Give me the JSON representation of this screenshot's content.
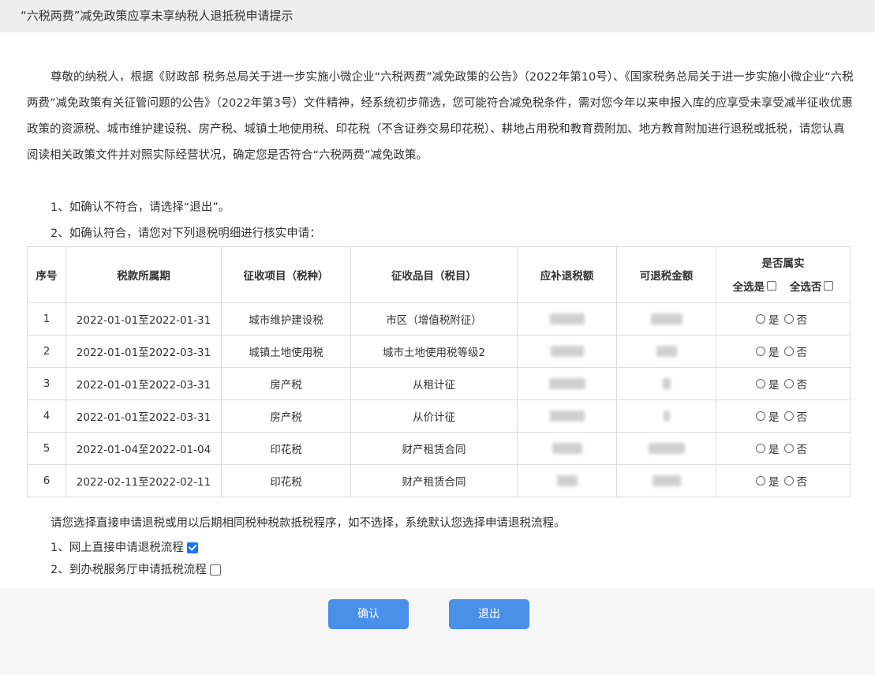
{
  "window": {
    "title": "“六税两费”减免政策应享未享纳税人退抵税申请提示"
  },
  "intro": {
    "paragraph": "尊敬的纳税人，根据《财政部 税务总局关于进一步实施小微企业“六税两费”减免政策的公告》（2022年第10号）、《国家税务总局关于进一步实施小微企业“六税两费”减免政策有关征管问题的公告》（2022年第3号）文件精神，经系统初步筛选，您可能符合减免税条件，需对您今年以来申报入库的应享受未享受减半征收优惠政策的资源税、城市维护建设税、房产税、城镇土地使用税、印花税（不含证券交易印花税）、耕地占用税和教育费附加、地方教育附加进行退税或抵税，请您认真阅读相关政策文件并对照实际经营状况，确定您是否符合“六税两费”减免政策。",
    "line1": "1、如确认不符合，请选择“退出”。",
    "line2": "2、如确认符合，请您对下列退税明细进行核实申请："
  },
  "table": {
    "headers": {
      "seq": "序号",
      "period": "税款所属期",
      "tax_item": "征收项目（税种）",
      "tax_subitem": "征收品目（税目）",
      "refund_due": "应补退税额",
      "refundable": "可退税金额",
      "confirm": "是否属实",
      "select_all_yes": "全选是",
      "select_all_no": "全选否"
    },
    "rows": [
      {
        "seq": "1",
        "period": "2022-01-01至2022-01-31",
        "tax_item": "城市维护建设税",
        "tax_subitem": "市区（增值税附征）",
        "yes": "是",
        "no": "否"
      },
      {
        "seq": "2",
        "period": "2022-01-01至2022-03-31",
        "tax_item": "城镇土地使用税",
        "tax_subitem": "城市土地使用税等级2",
        "yes": "是",
        "no": "否"
      },
      {
        "seq": "3",
        "period": "2022-01-01至2022-03-31",
        "tax_item": "房产税",
        "tax_subitem": "从租计征",
        "yes": "是",
        "no": "否"
      },
      {
        "seq": "4",
        "period": "2022-01-01至2022-03-31",
        "tax_item": "房产税",
        "tax_subitem": "从价计征",
        "yes": "是",
        "no": "否"
      },
      {
        "seq": "5",
        "period": "2022-01-04至2022-01-04",
        "tax_item": "印花税",
        "tax_subitem": "财产租赁合同",
        "yes": "是",
        "no": "否"
      },
      {
        "seq": "6",
        "period": "2022-02-11至2022-02-11",
        "tax_item": "印花税",
        "tax_subitem": "财产租赁合同",
        "yes": "是",
        "no": "否"
      }
    ]
  },
  "choice": {
    "intro": "请您选择直接申请退税或用以后期相同税种税款抵税程序，如不选择，系统默认您选择申请退税流程。",
    "option1": "1、网上直接申请退税流程",
    "option1_checked": true,
    "option2": "2、到办税服务厅申请抵税流程",
    "option2_checked": false
  },
  "buttons": {
    "confirm": "确认",
    "exit": "退出"
  },
  "colors": {
    "button": "#4a8fe8",
    "checkbox_checked": "#1a73e8"
  }
}
